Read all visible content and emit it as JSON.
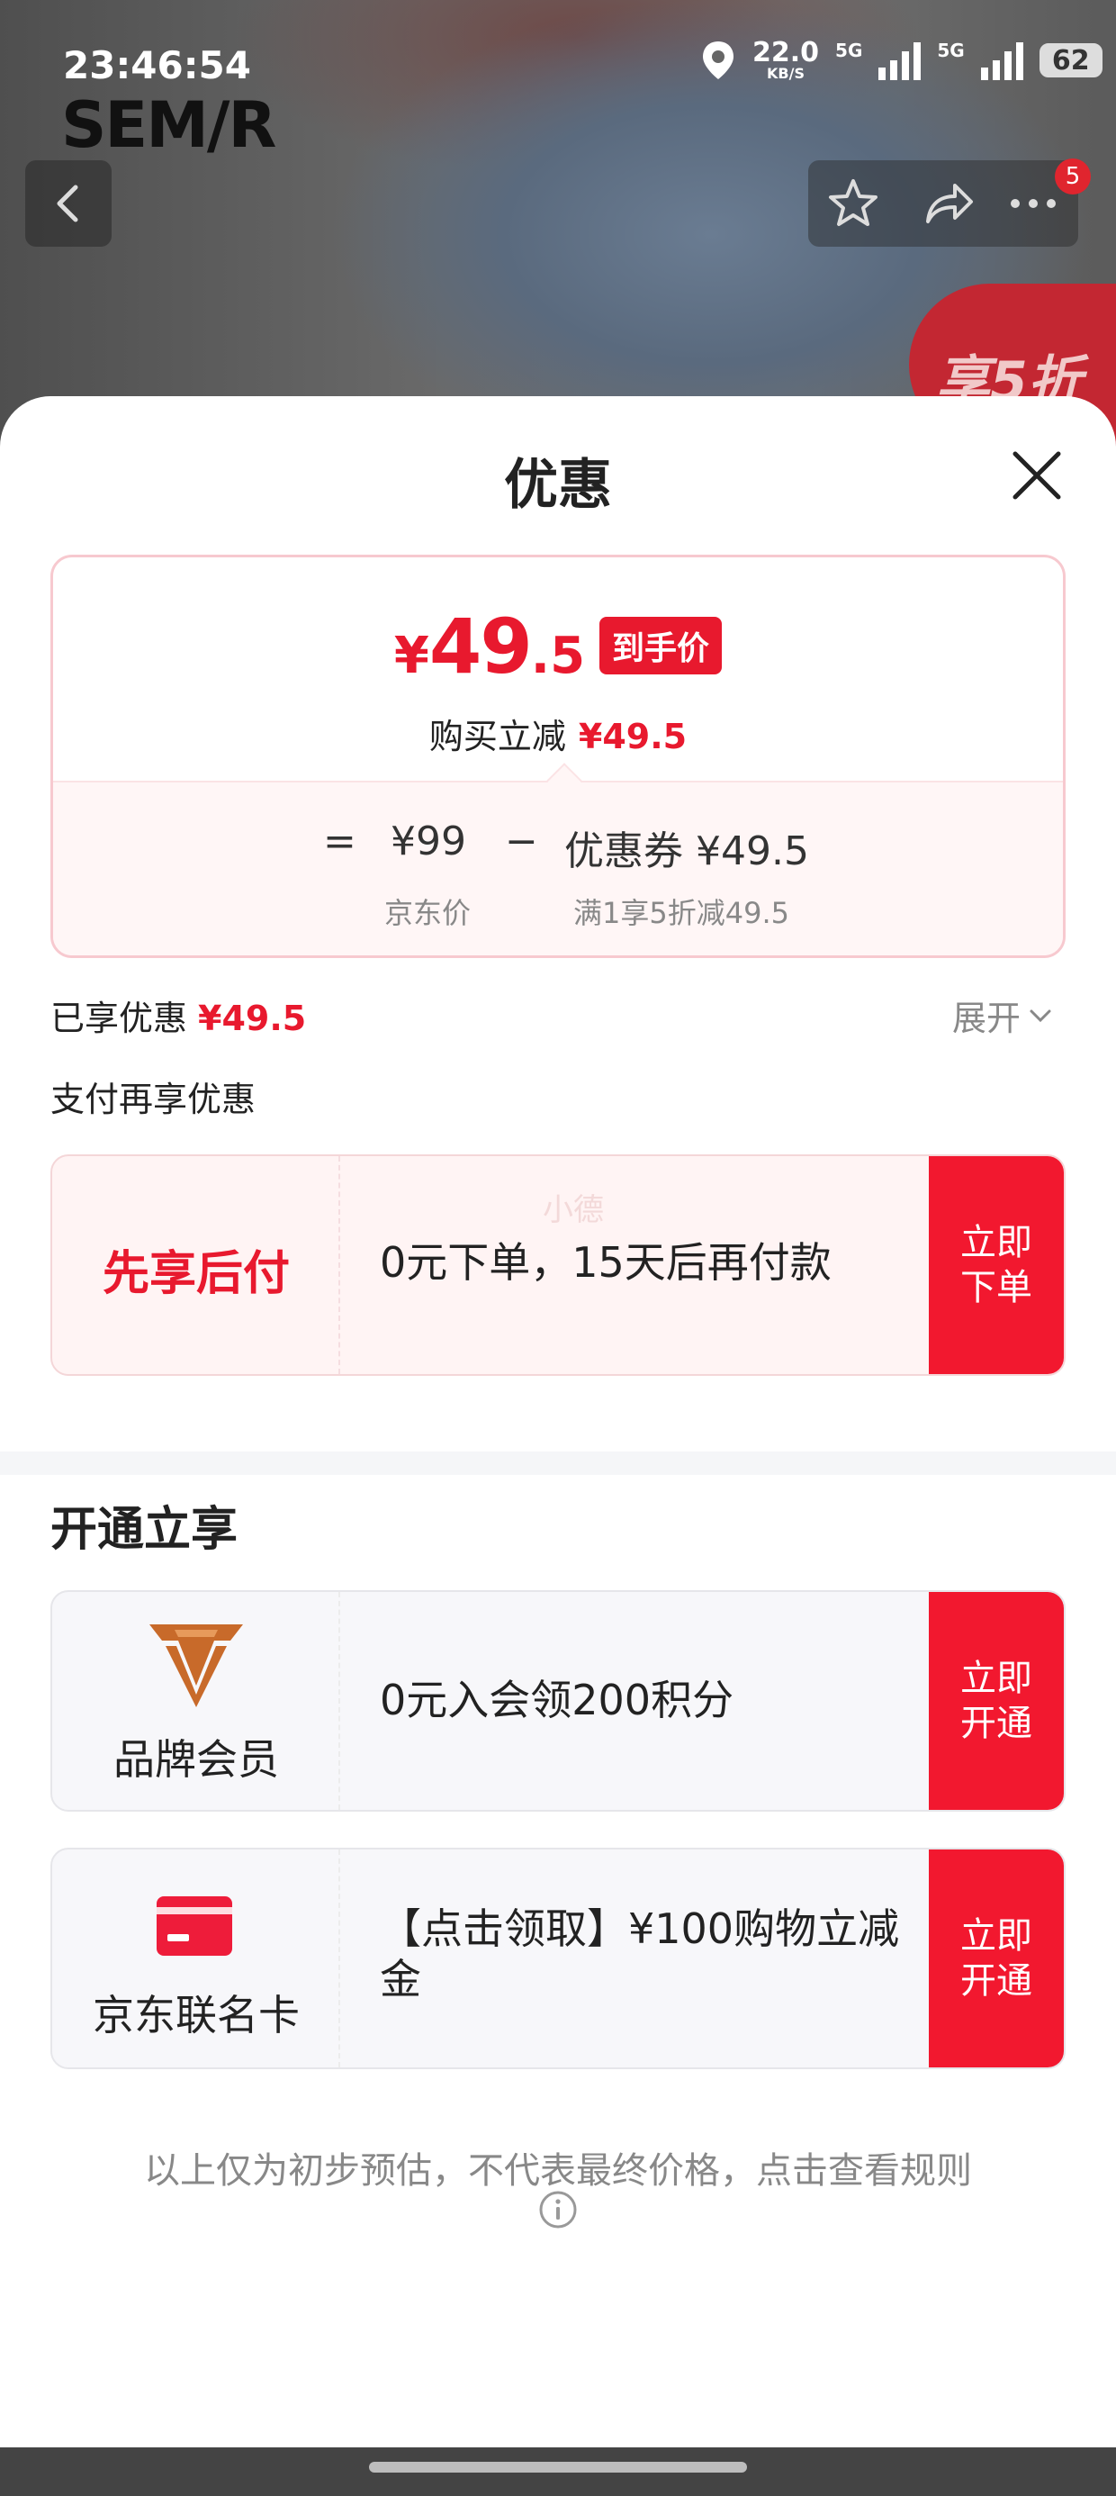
{
  "status_bar": {
    "time": "23:46:54",
    "speed_value": "22.0",
    "speed_unit": "KB/S",
    "net1": "5G",
    "net2": "5G",
    "battery": "62"
  },
  "header": {
    "brand": "SEM/R",
    "badge_count": "5",
    "promo_badge": "享5折"
  },
  "sheet": {
    "title": "优惠",
    "price_card": {
      "currency": "¥",
      "price_int": "49",
      "price_dec": ".5",
      "final_tag": "到手价",
      "reduce_label": "购买立减",
      "reduce_amount": "¥49.5",
      "eq": "=",
      "jd_price": "¥99",
      "minus": "−",
      "coupon": "优惠券 ¥49.5",
      "jd_price_label": "京东价",
      "coupon_desc": "满1享5折减49.5"
    },
    "enjoyed_label": "已享优惠",
    "enjoyed_amount": "¥49.5",
    "expand_label": "展开",
    "pay_more_label": "支付再享优惠",
    "pay_later": {
      "label": "先享后付",
      "watermark": "小德",
      "desc": "0元下单，15天后再付款",
      "button": "立即\n下单"
    },
    "open_section_title": "开通立享",
    "brand_member": {
      "label": "品牌会员",
      "desc": "0元入会领200积分",
      "button": "立即\n开通"
    },
    "jd_card": {
      "label": "京东联名卡",
      "desc": "【点击领取】¥100购物立减金",
      "button": "立即\n开通"
    },
    "disclaimer": "以上仅为初步预估，不代表最终价格，点击查看规则"
  },
  "colors": {
    "accent_red": "#e8192e",
    "button_red": "#f2182f",
    "member_logo": "#c86a2a"
  }
}
